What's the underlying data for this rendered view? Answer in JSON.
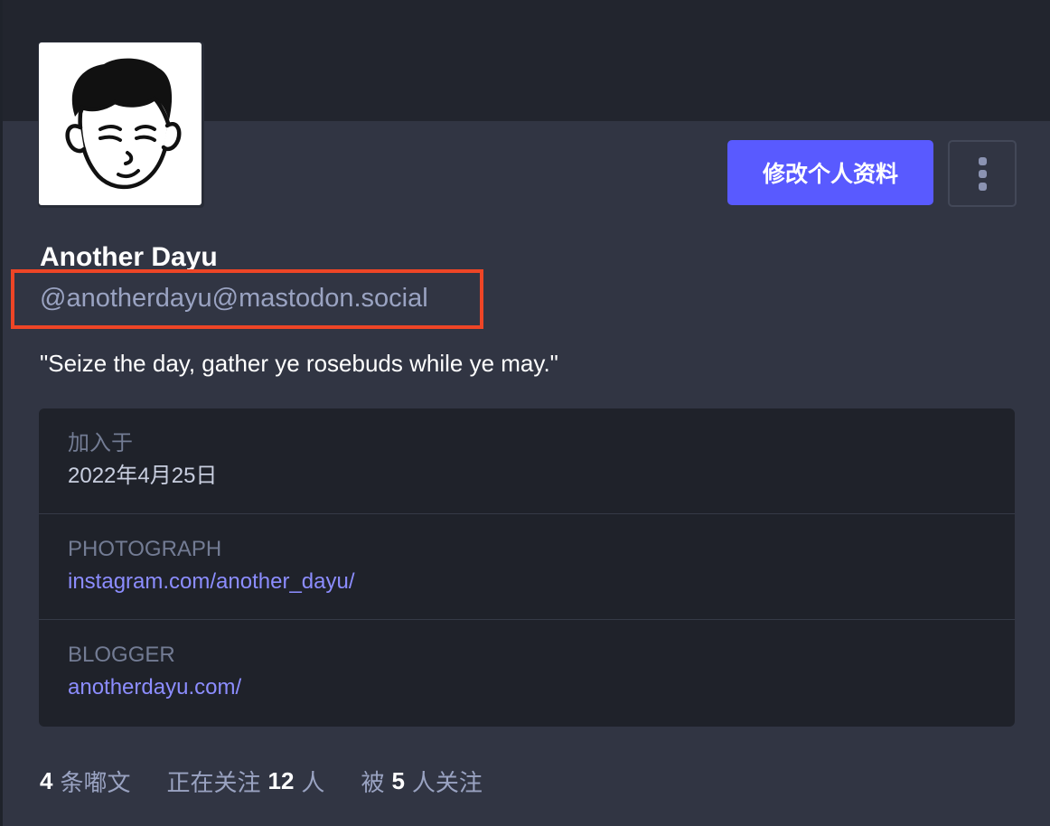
{
  "profile": {
    "display_name": "Another Dayu",
    "handle": "@anotherdayu@mastodon.social",
    "bio": "\"Seize the day, gather ye rosebuds while ye may.\""
  },
  "actions": {
    "edit_profile_label": "修改个人资料",
    "more_icon": "vertical-ellipsis-icon"
  },
  "fields": [
    {
      "label": "加入于",
      "value": "2022年4月25日"
    },
    {
      "label": "PHOTOGRAPH",
      "value": "instagram.com/another_dayu/"
    },
    {
      "label": "BLOGGER",
      "value": "anotherdayu.com/"
    }
  ],
  "stats": {
    "posts_count": "4",
    "posts_label": "条嘟文",
    "following_prefix": "正在关注",
    "following_count": "12",
    "following_suffix": "人",
    "followers_prefix": "被",
    "followers_count": "5",
    "followers_suffix": "人关注"
  },
  "colors": {
    "accent": "#595aff",
    "link": "#8c8dff",
    "highlight_box": "#ee4526",
    "background": "#313543"
  }
}
